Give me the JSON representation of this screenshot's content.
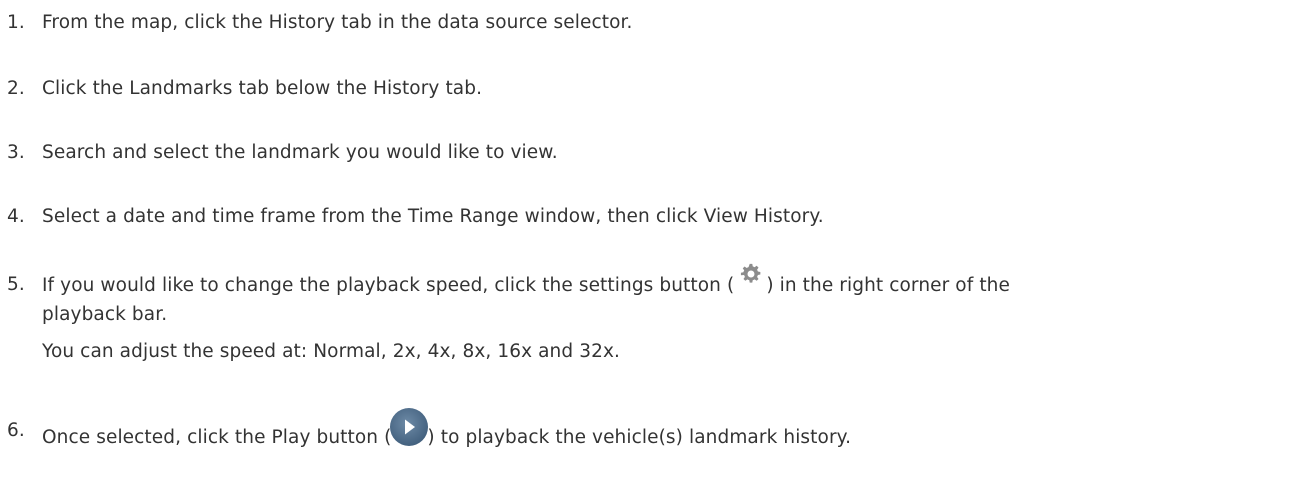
{
  "steps": [
    {
      "number": "1.",
      "text": "From the map, click the History tab in the data source selector."
    },
    {
      "number": "2.",
      "text": "Click the Landmarks tab below the History tab."
    },
    {
      "number": "3.",
      "text": "Search and select the landmark you would like to view."
    },
    {
      "number": "4.",
      "text": "Select a date and time frame from the Time Range window, then click View History."
    },
    {
      "number": "5.",
      "text_before_icon": "If you would like to change the playback speed, click the settings button (",
      "icon": "gear-icon",
      "text_after_icon": ") in the right corner of the",
      "line2": "playback bar.",
      "line3": "You can adjust the speed at: Normal, 2x, 4x, 8x, 16x and 32x."
    },
    {
      "number": "6.",
      "text_before_icon": "Once selected, click the Play button (",
      "icon": "play-button-icon",
      "text_after_icon": ") to playback the vehicle(s) landmark history."
    }
  ],
  "colors": {
    "text": "#333333",
    "icon_gray": "#8c8c8c",
    "play_blue": "#4a6a8a"
  }
}
